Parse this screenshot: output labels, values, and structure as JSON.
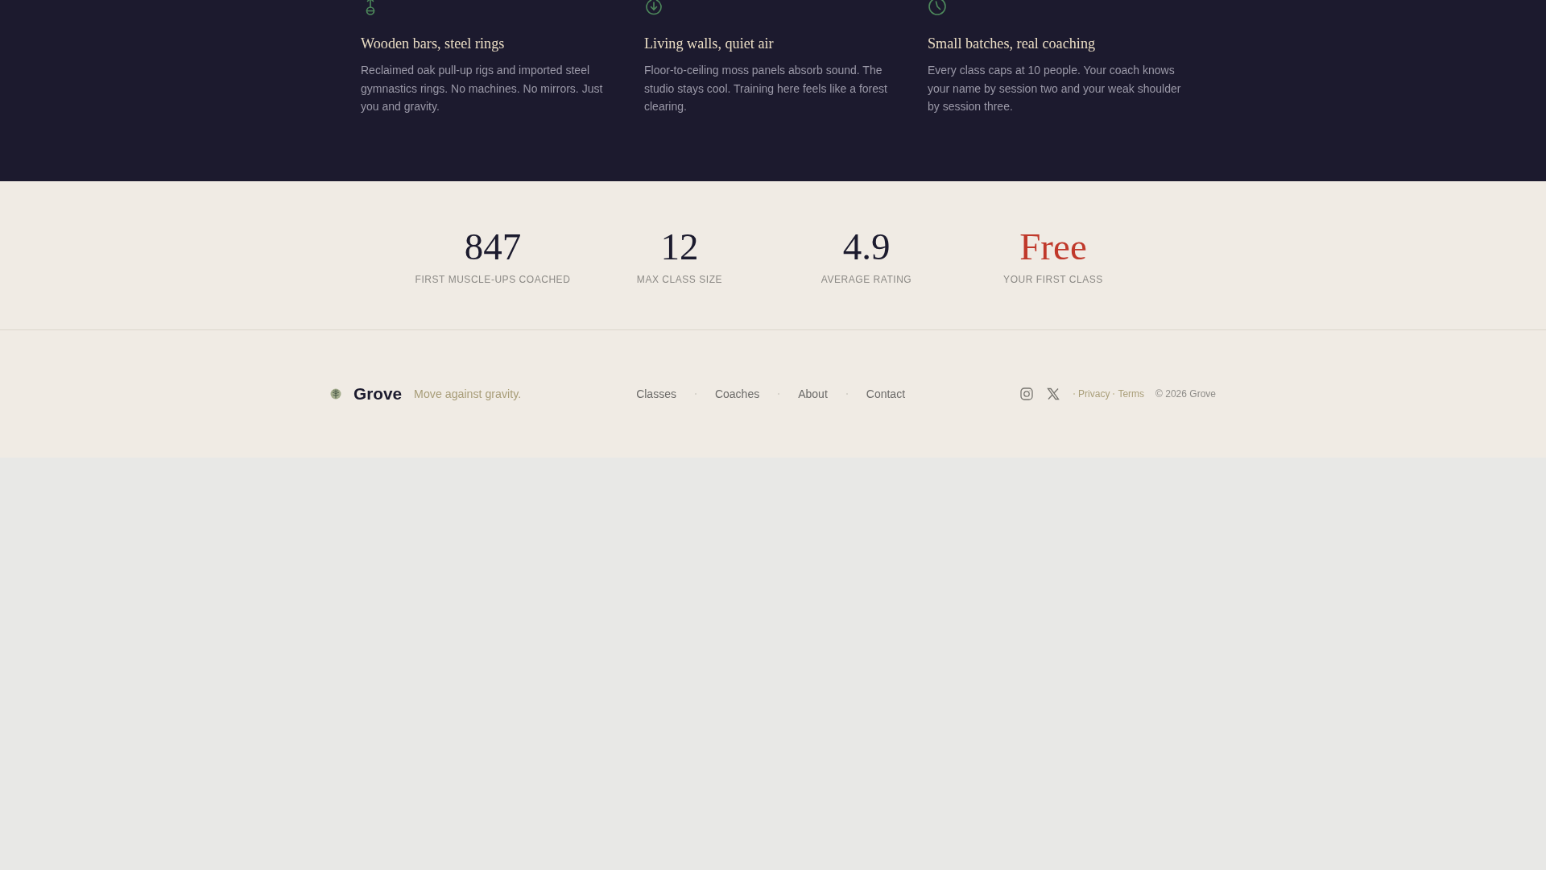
{
  "features": [
    {
      "title": "Wooden bars, steel rings",
      "text": "Reclaimed oak pull-up rigs and imported steel gymnastics rings. No machines. No mirrors. Just you and gravity."
    },
    {
      "title": "Living walls, quiet air",
      "text": "Floor-to-ceiling moss panels absorb sound. The studio stays cool. Training here feels like a forest clearing."
    },
    {
      "title": "Small batches, real coaching",
      "text": "Every class caps at 10 people. Your coach knows your name by session two and your weak shoulder by session three."
    }
  ],
  "stats": [
    {
      "value": "847",
      "label": "FIRST MUSCLE-UPS COACHED",
      "color": "#1c1b2e"
    },
    {
      "value": "12",
      "label": "MAX CLASS SIZE",
      "color": "#1c1b2e"
    },
    {
      "value": "4.9",
      "label": "AVERAGE RATING",
      "color": "#1c1b2e"
    },
    {
      "value": "Free",
      "label": "YOUR FIRST CLASS",
      "color": "#c0392b"
    }
  ],
  "footer": {
    "brand": "Grove",
    "tagline": "Move against gravity.",
    "nav": [
      "Classes",
      "Coaches",
      "About",
      "Contact"
    ],
    "legal_links": [
      "Privacy",
      "Terms"
    ],
    "copyright": "© 2026 Grove"
  }
}
